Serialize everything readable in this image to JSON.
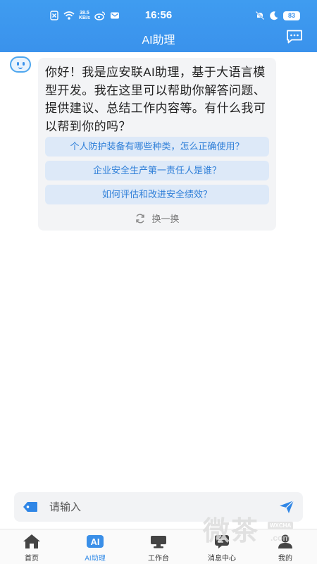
{
  "status_bar": {
    "net_speed_value": "38.5",
    "net_speed_unit": "KB/s",
    "time": "16:56",
    "battery": "83"
  },
  "header": {
    "title": "AI助理",
    "chat_icon": "chat-bubble-icon"
  },
  "assistant": {
    "avatar_icon": "robot-avatar-icon",
    "greeting": "你好！我是应安联AI助理，基于大语言模型开发。我在这里可以帮助你解答问题、提供建议、总结工作内容等。有什么我可以帮到你的吗？",
    "suggestions": [
      "个人防护装备有哪些种类，怎么正确使用？",
      "企业安全生产第一责任人是谁？",
      "如何评估和改进安全绩效？"
    ],
    "refresh_label": "换一换"
  },
  "input": {
    "placeholder": "请输入",
    "tag_icon": "tag-icon",
    "send_icon": "send-icon"
  },
  "tabbar": {
    "active_color": "#3a8fe8",
    "items": [
      {
        "label": "首页",
        "icon": "home-icon"
      },
      {
        "label": "AI助理",
        "icon": "ai-icon"
      },
      {
        "label": "工作台",
        "icon": "workbench-icon"
      },
      {
        "label": "消息中心",
        "icon": "message-icon"
      },
      {
        "label": "我的",
        "icon": "profile-icon"
      }
    ]
  },
  "watermark": {
    "text": "微茶",
    "latin": "WXCHA",
    "domain": ".com"
  }
}
